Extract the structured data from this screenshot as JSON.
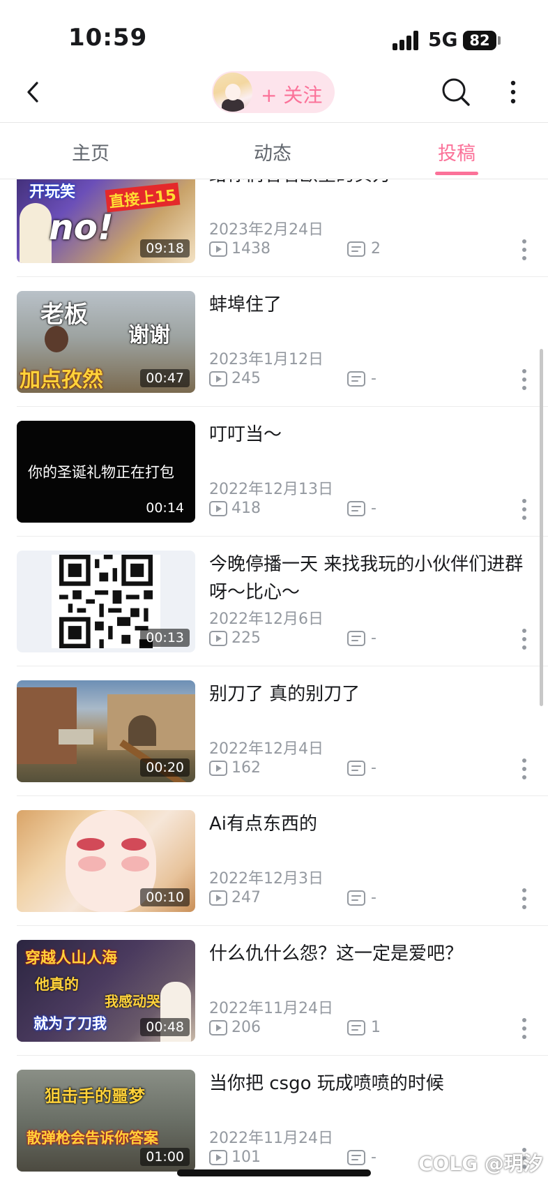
{
  "status_bar": {
    "time": "10:59",
    "network": "5G",
    "battery": "82"
  },
  "header": {
    "follow_label": "+ 关注",
    "accent_color": "#fb7299"
  },
  "tabs": [
    {
      "label": "主页",
      "active": false
    },
    {
      "label": "动态",
      "active": false
    },
    {
      "label": "投稿",
      "active": true
    }
  ],
  "videos": [
    {
      "title": "给你们看看欧皇的实力",
      "date": "2023年2月24日",
      "plays": "1438",
      "comments": "2",
      "duration": "09:18",
      "thumb_text": [
        "开玩笑",
        "直接上15",
        "no!"
      ]
    },
    {
      "title": "蚌埠住了",
      "date": "2023年1月12日",
      "plays": "245",
      "comments": "-",
      "duration": "00:47",
      "thumb_text": [
        "老板",
        "谢谢",
        "加点孜然"
      ]
    },
    {
      "title": "叮叮当～",
      "date": "2022年12月13日",
      "plays": "418",
      "comments": "-",
      "duration": "00:14",
      "thumb_text": [
        "你的圣诞礼物正在打包"
      ]
    },
    {
      "title": "今晚停播一天 来找我玩的小伙伴们进群呀～比心～",
      "date": "2022年12月6日",
      "plays": "225",
      "comments": "-",
      "duration": "00:13",
      "thumb_text": []
    },
    {
      "title": "别刀了 真的别刀了",
      "date": "2022年12月4日",
      "plays": "162",
      "comments": "-",
      "duration": "00:20",
      "thumb_text": []
    },
    {
      "title": "Ai有点东西的",
      "date": "2022年12月3日",
      "plays": "247",
      "comments": "-",
      "duration": "00:10",
      "thumb_text": []
    },
    {
      "title": "什么仇什么怨？这一定是爱吧？",
      "date": "2022年11月24日",
      "plays": "206",
      "comments": "1",
      "duration": "00:48",
      "thumb_text": [
        "穿越人山人海",
        "他真的",
        "我感动哭了",
        "就为了刀我"
      ]
    },
    {
      "title": "当你把 csgo 玩成喷喷的时候",
      "date": "2022年11月24日",
      "plays": "101",
      "comments": "-",
      "duration": "01:00",
      "thumb_text": [
        "狙击手的噩梦",
        "散弹枪会告诉你答案"
      ]
    }
  ],
  "watermark": "COLG @玥汐"
}
